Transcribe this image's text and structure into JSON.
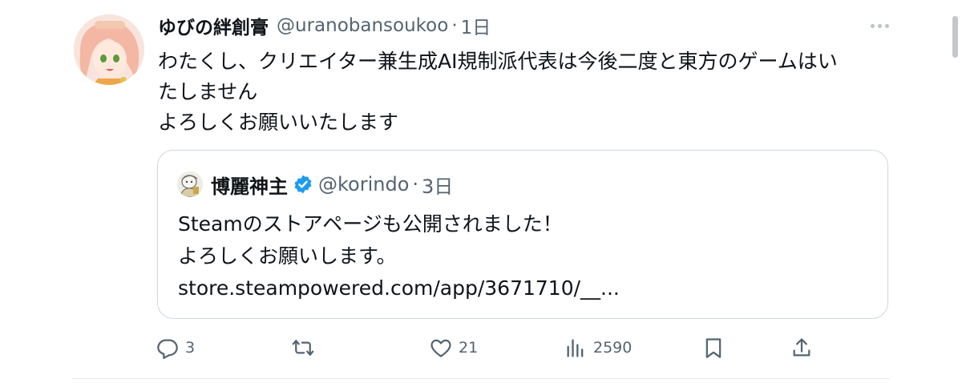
{
  "post": {
    "display_name": "ゆびの絆創膏",
    "handle": "@uranobansoukoo",
    "separator": "·",
    "time": "1日",
    "text_lines": [
      "わたくし、クリエイター兼生成AI規制派代表は今後二度と東方のゲームはい",
      "たしません",
      "よろしくお願いいたします"
    ]
  },
  "quoted_post": {
    "display_name": "博麗神主",
    "handle": "@korindo",
    "separator": "·",
    "time": "3日",
    "text_lines": [
      "Steamのストアページも公開されました！",
      "よろしくお願いします。",
      "store.steampowered.com/app/3671710/__..."
    ]
  },
  "actions": {
    "reply": {
      "icon": "reply-icon",
      "count": "3"
    },
    "repost": {
      "icon": "repost-icon",
      "count": ""
    },
    "like": {
      "icon": "heart-icon",
      "count": "21"
    },
    "views": {
      "icon": "views-icon",
      "count": "2590"
    },
    "bookmark": {
      "icon": "bookmark-icon"
    },
    "share": {
      "icon": "share-icon"
    }
  },
  "colors": {
    "text_primary": "#0f1419",
    "text_secondary": "#536471",
    "verified_blue": "#1d9bf0",
    "border": "#cfd9de"
  }
}
